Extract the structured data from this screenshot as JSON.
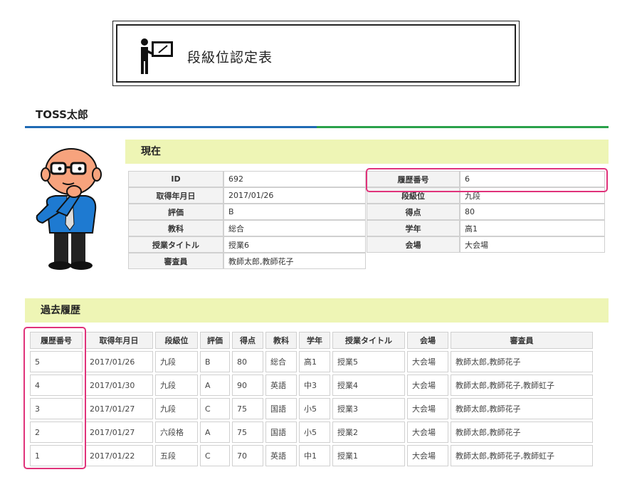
{
  "title": "段級位認定表",
  "user_name": "TOSS太郎",
  "current": {
    "heading": "現在",
    "left": [
      {
        "label": "ID",
        "value": "692"
      },
      {
        "label": "取得年月日",
        "value": "2017/01/26"
      },
      {
        "label": "評価",
        "value": "B"
      },
      {
        "label": "教科",
        "value": "総合"
      },
      {
        "label": "授業タイトル",
        "value": "授業6"
      },
      {
        "label": "審査員",
        "value": "教師太郎,教師花子"
      }
    ],
    "right": [
      {
        "label": "履歴番号",
        "value": "6"
      },
      {
        "label": "段級位",
        "value": "九段"
      },
      {
        "label": "得点",
        "value": "80"
      },
      {
        "label": "学年",
        "value": "高1"
      },
      {
        "label": "会場",
        "value": "大会場"
      }
    ]
  },
  "history": {
    "heading": "過去履歴",
    "columns": [
      "履歴番号",
      "取得年月日",
      "段級位",
      "評価",
      "得点",
      "教科",
      "学年",
      "授業タイトル",
      "会場",
      "審査員"
    ],
    "rows": [
      [
        "5",
        "2017/01/26",
        "九段",
        "B",
        "80",
        "総合",
        "高1",
        "授業5",
        "大会場",
        "教師太郎,教師花子"
      ],
      [
        "4",
        "2017/01/30",
        "九段",
        "A",
        "90",
        "英語",
        "中3",
        "授業4",
        "大会場",
        "教師太郎,教師花子,教師虹子"
      ],
      [
        "3",
        "2017/01/27",
        "九段",
        "C",
        "75",
        "国語",
        "小5",
        "授業3",
        "大会場",
        "教師太郎,教師花子"
      ],
      [
        "2",
        "2017/01/27",
        "六段格",
        "A",
        "75",
        "国語",
        "小5",
        "授業2",
        "大会場",
        "教師太郎,教師花子"
      ],
      [
        "1",
        "2017/01/22",
        "五段",
        "C",
        "70",
        "英語",
        "中1",
        "授業1",
        "大会場",
        "教師太郎,教師花子,教師虹子"
      ]
    ]
  },
  "colors": {
    "highlight": "#e0327a",
    "section_bg": "#eef5b5",
    "rule_blue": "#1f6ab4",
    "rule_green": "#2aa14a"
  },
  "icons": [
    "presenter-icon",
    "thinking-man-avatar"
  ]
}
